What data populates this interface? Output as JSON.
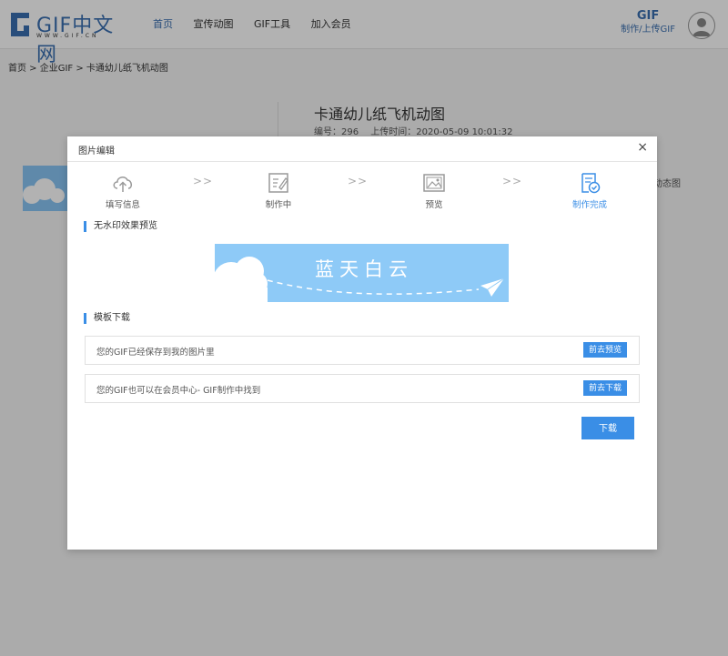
{
  "header": {
    "logo_text": "GIF中文网",
    "logo_sub": "WWW.GIF.CN",
    "nav": [
      {
        "label": "首页",
        "active": true
      },
      {
        "label": "宣传动图",
        "active": false
      },
      {
        "label": "GIF工具",
        "active": false
      },
      {
        "label": "加入会员",
        "active": false
      }
    ],
    "make_badge": "GIF",
    "make_label": "制作/上传GIF"
  },
  "breadcrumb": "首页 > 企业GIF > 卡通幼儿纸飞机动图",
  "detail": {
    "title": "卡通幼儿纸飞机动图",
    "number": "编号：296",
    "upload_time": "上传时间：2020-05-09 10:01:32",
    "right_hint": "动态图"
  },
  "modal": {
    "title": "图片编辑",
    "close": "×",
    "steps": [
      {
        "label": "填写信息",
        "icon": "cloud-upload-icon",
        "done": false
      },
      {
        "label": "制作中",
        "icon": "edit-icon",
        "done": false
      },
      {
        "label": "预览",
        "icon": "image-icon",
        "done": false
      },
      {
        "label": "制作完成",
        "icon": "check-doc-icon",
        "done": true
      }
    ],
    "step_arrow": ">>",
    "preview_title": "无水印效果预览",
    "banner_text": "蓝天白云",
    "download_section_title": "模板下载",
    "rows": [
      {
        "text": "您的GIF已经保存到我的图片里",
        "button": "前去预览"
      },
      {
        "text": "您的GIF也可以在会员中心- GIF制作中找到",
        "button": "前去下载"
      }
    ],
    "download_button": "下载"
  },
  "colors": {
    "accent": "#3a8ee6",
    "banner_bg": "#8ecaf7"
  }
}
